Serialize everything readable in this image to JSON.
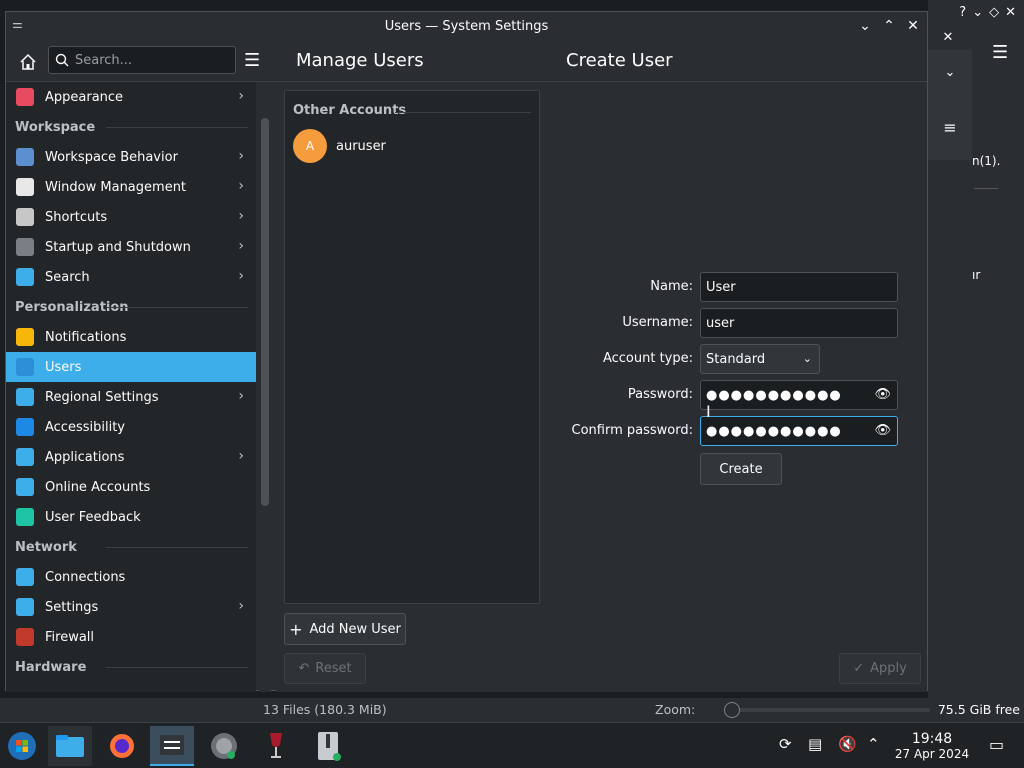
{
  "window": {
    "title": "Users — System Settings"
  },
  "background_window": {
    "fragment_text_1": "n(1).",
    "fragment_text_2": "ır"
  },
  "statusbar": {
    "files": "13 Files (180.3 MiB)",
    "zoom_label": "Zoom:",
    "free": "75.5 GiB free"
  },
  "sidebar": {
    "search_placeholder": "Search...",
    "items": [
      {
        "type": "item",
        "label": "Appearance",
        "icon": "appearance-icon",
        "color": "#e84a5f",
        "chevron": true
      },
      {
        "type": "section",
        "label": "Workspace"
      },
      {
        "type": "item",
        "label": "Workspace Behavior",
        "icon": "workspace-behavior-icon",
        "color": "#5b8fd0",
        "chevron": true
      },
      {
        "type": "item",
        "label": "Window Management",
        "icon": "window-management-icon",
        "color": "#e8e8e8",
        "chevron": true
      },
      {
        "type": "item",
        "label": "Shortcuts",
        "icon": "keyboard-icon",
        "color": "#c7c7c7",
        "chevron": true
      },
      {
        "type": "item",
        "label": "Startup and Shutdown",
        "icon": "startup-shutdown-icon",
        "color": "#7a7f85",
        "chevron": true
      },
      {
        "type": "item",
        "label": "Search",
        "icon": "search-icon",
        "color": "#3daee9",
        "chevron": true
      },
      {
        "type": "section",
        "label": "Personalization"
      },
      {
        "type": "item",
        "label": "Notifications",
        "icon": "bell-icon",
        "color": "#f6b60a",
        "chevron": false
      },
      {
        "type": "item",
        "label": "Users",
        "icon": "users-icon",
        "color": "#2d8fd5",
        "chevron": false,
        "active": true
      },
      {
        "type": "item",
        "label": "Regional Settings",
        "icon": "regional-settings-icon",
        "color": "#3daee9",
        "chevron": true
      },
      {
        "type": "item",
        "label": "Accessibility",
        "icon": "accessibility-icon",
        "color": "#1e88e5",
        "chevron": false
      },
      {
        "type": "item",
        "label": "Applications",
        "icon": "applications-icon",
        "color": "#3daee9",
        "chevron": true
      },
      {
        "type": "item",
        "label": "Online Accounts",
        "icon": "online-accounts-icon",
        "color": "#3daee9",
        "chevron": false
      },
      {
        "type": "item",
        "label": "User Feedback",
        "icon": "feedback-icon",
        "color": "#1dc5a5",
        "chevron": false
      },
      {
        "type": "section",
        "label": "Network"
      },
      {
        "type": "item",
        "label": "Connections",
        "icon": "globe-icon",
        "color": "#3daee9",
        "chevron": false
      },
      {
        "type": "item",
        "label": "Settings",
        "icon": "network-settings-icon",
        "color": "#3daee9",
        "chevron": true
      },
      {
        "type": "item",
        "label": "Firewall",
        "icon": "firewall-icon",
        "color": "#c0392b",
        "chevron": false
      },
      {
        "type": "section",
        "label": "Hardware"
      }
    ]
  },
  "main": {
    "left_title": "Manage Users",
    "right_title": "Create User",
    "accounts_section": "Other Accounts",
    "accounts": [
      {
        "initial": "A",
        "name": "auruser"
      }
    ],
    "add_user_label": "Add New User",
    "reset_label": "Reset",
    "apply_label": "Apply"
  },
  "form": {
    "name_label": "Name:",
    "name_value": "User",
    "username_label": "Username:",
    "username_value": "user",
    "account_type_label": "Account type:",
    "account_type_value": "Standard",
    "password_label": "Password:",
    "password_value": "●●●●●●●●●●●",
    "confirm_label": "Confirm password:",
    "confirm_value": "●●●●●●●●●●●",
    "create_label": "Create"
  },
  "taskbar": {
    "items": [
      "start-menu-icon",
      "file-manager-icon",
      "firefox-icon",
      "system-settings-icon",
      "disk-usage-icon",
      "wine-icon",
      "archive-icon"
    ],
    "clock_time": "19:48",
    "clock_date": "27 Apr 2024"
  },
  "colors": {
    "accent": "#3daee9",
    "avatar": "#f59d3d"
  }
}
